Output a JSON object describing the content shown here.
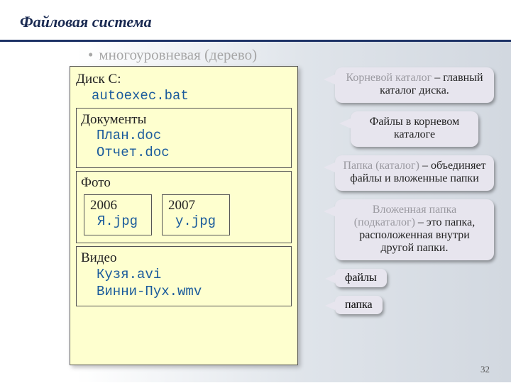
{
  "header": {
    "title": "Файловая система"
  },
  "bullet": {
    "text": "многоуровневая (дерево)"
  },
  "tree": {
    "disk_label": "Диск C:",
    "root_file": "autoexec.bat",
    "docs": {
      "title": "Документы",
      "files": [
        "План.doc",
        "Отчет.doc"
      ]
    },
    "photo": {
      "title": "Фото",
      "years": [
        {
          "label": "2006",
          "file": "Я.jpg"
        },
        {
          "label": "2007",
          "file": "y.jpg"
        }
      ]
    },
    "video": {
      "title": "Видео",
      "files": [
        "Кузя.avi",
        "Винни-Пух.wmv"
      ]
    }
  },
  "callouts": {
    "c1_lead": "Корневой каталог",
    "c1_rest": " – главный каталог диска.",
    "c2": "Файлы в корневом каталоге",
    "c3_lead": "Папка (каталог)",
    "c3_rest": " – объединяет файлы и вложенные папки",
    "c4_lead": "Вложенная папка (подкаталог)",
    "c4_rest": " – это папка, расположенная внутри другой папки."
  },
  "tags": {
    "files": "файлы",
    "folder": "папка"
  },
  "page_number": "32"
}
